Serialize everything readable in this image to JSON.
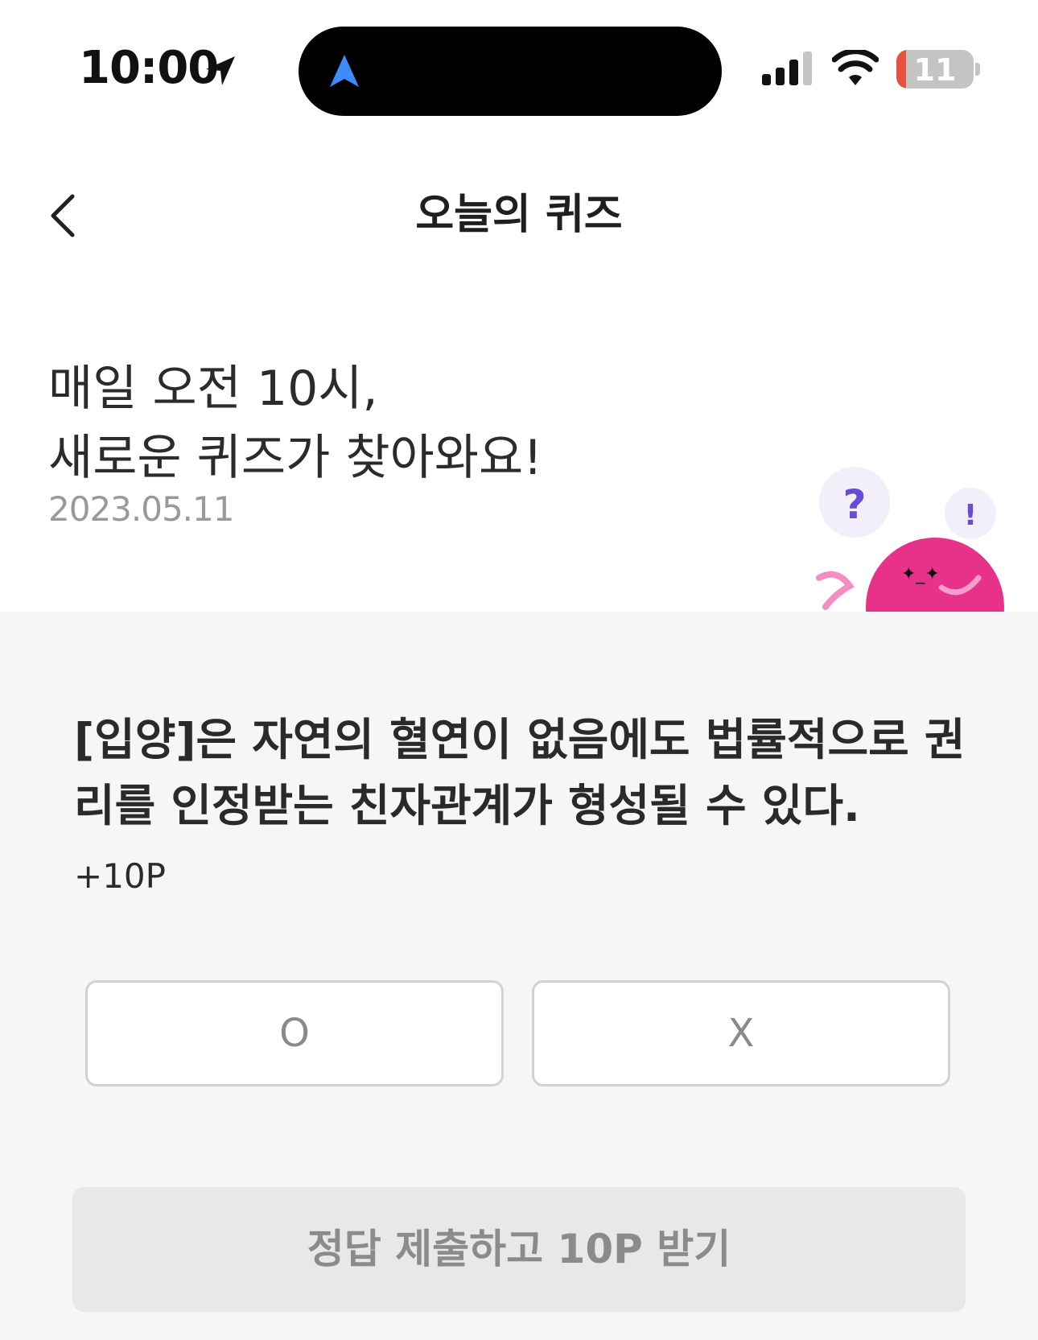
{
  "status_bar": {
    "time": "10:00",
    "battery_level": "11"
  },
  "header": {
    "title": "오늘의 퀴즈",
    "back_icon": "chevron-left-icon"
  },
  "hero": {
    "headline": "매일 오전 10시,\n새로운 퀴즈가 찾아와요!",
    "date": "2023.05.11",
    "mascot_bubbles": [
      "?",
      "!"
    ]
  },
  "quiz": {
    "question": "[입양]은 자연의 혈연이 없음에도 법률적으로 권리를 인정받는 친자관계가 형성될 수 있다.",
    "points": "+10P",
    "options": [
      "O",
      "X"
    ],
    "submit_label": "정답 제출하고 10P 받기"
  },
  "colors": {
    "mascot": "#e8328a",
    "bubble": "#f2effa",
    "accent_purple": "#6b4ad6",
    "nav_arrow": "#3d8bff",
    "battery_low": "#e5533f"
  }
}
